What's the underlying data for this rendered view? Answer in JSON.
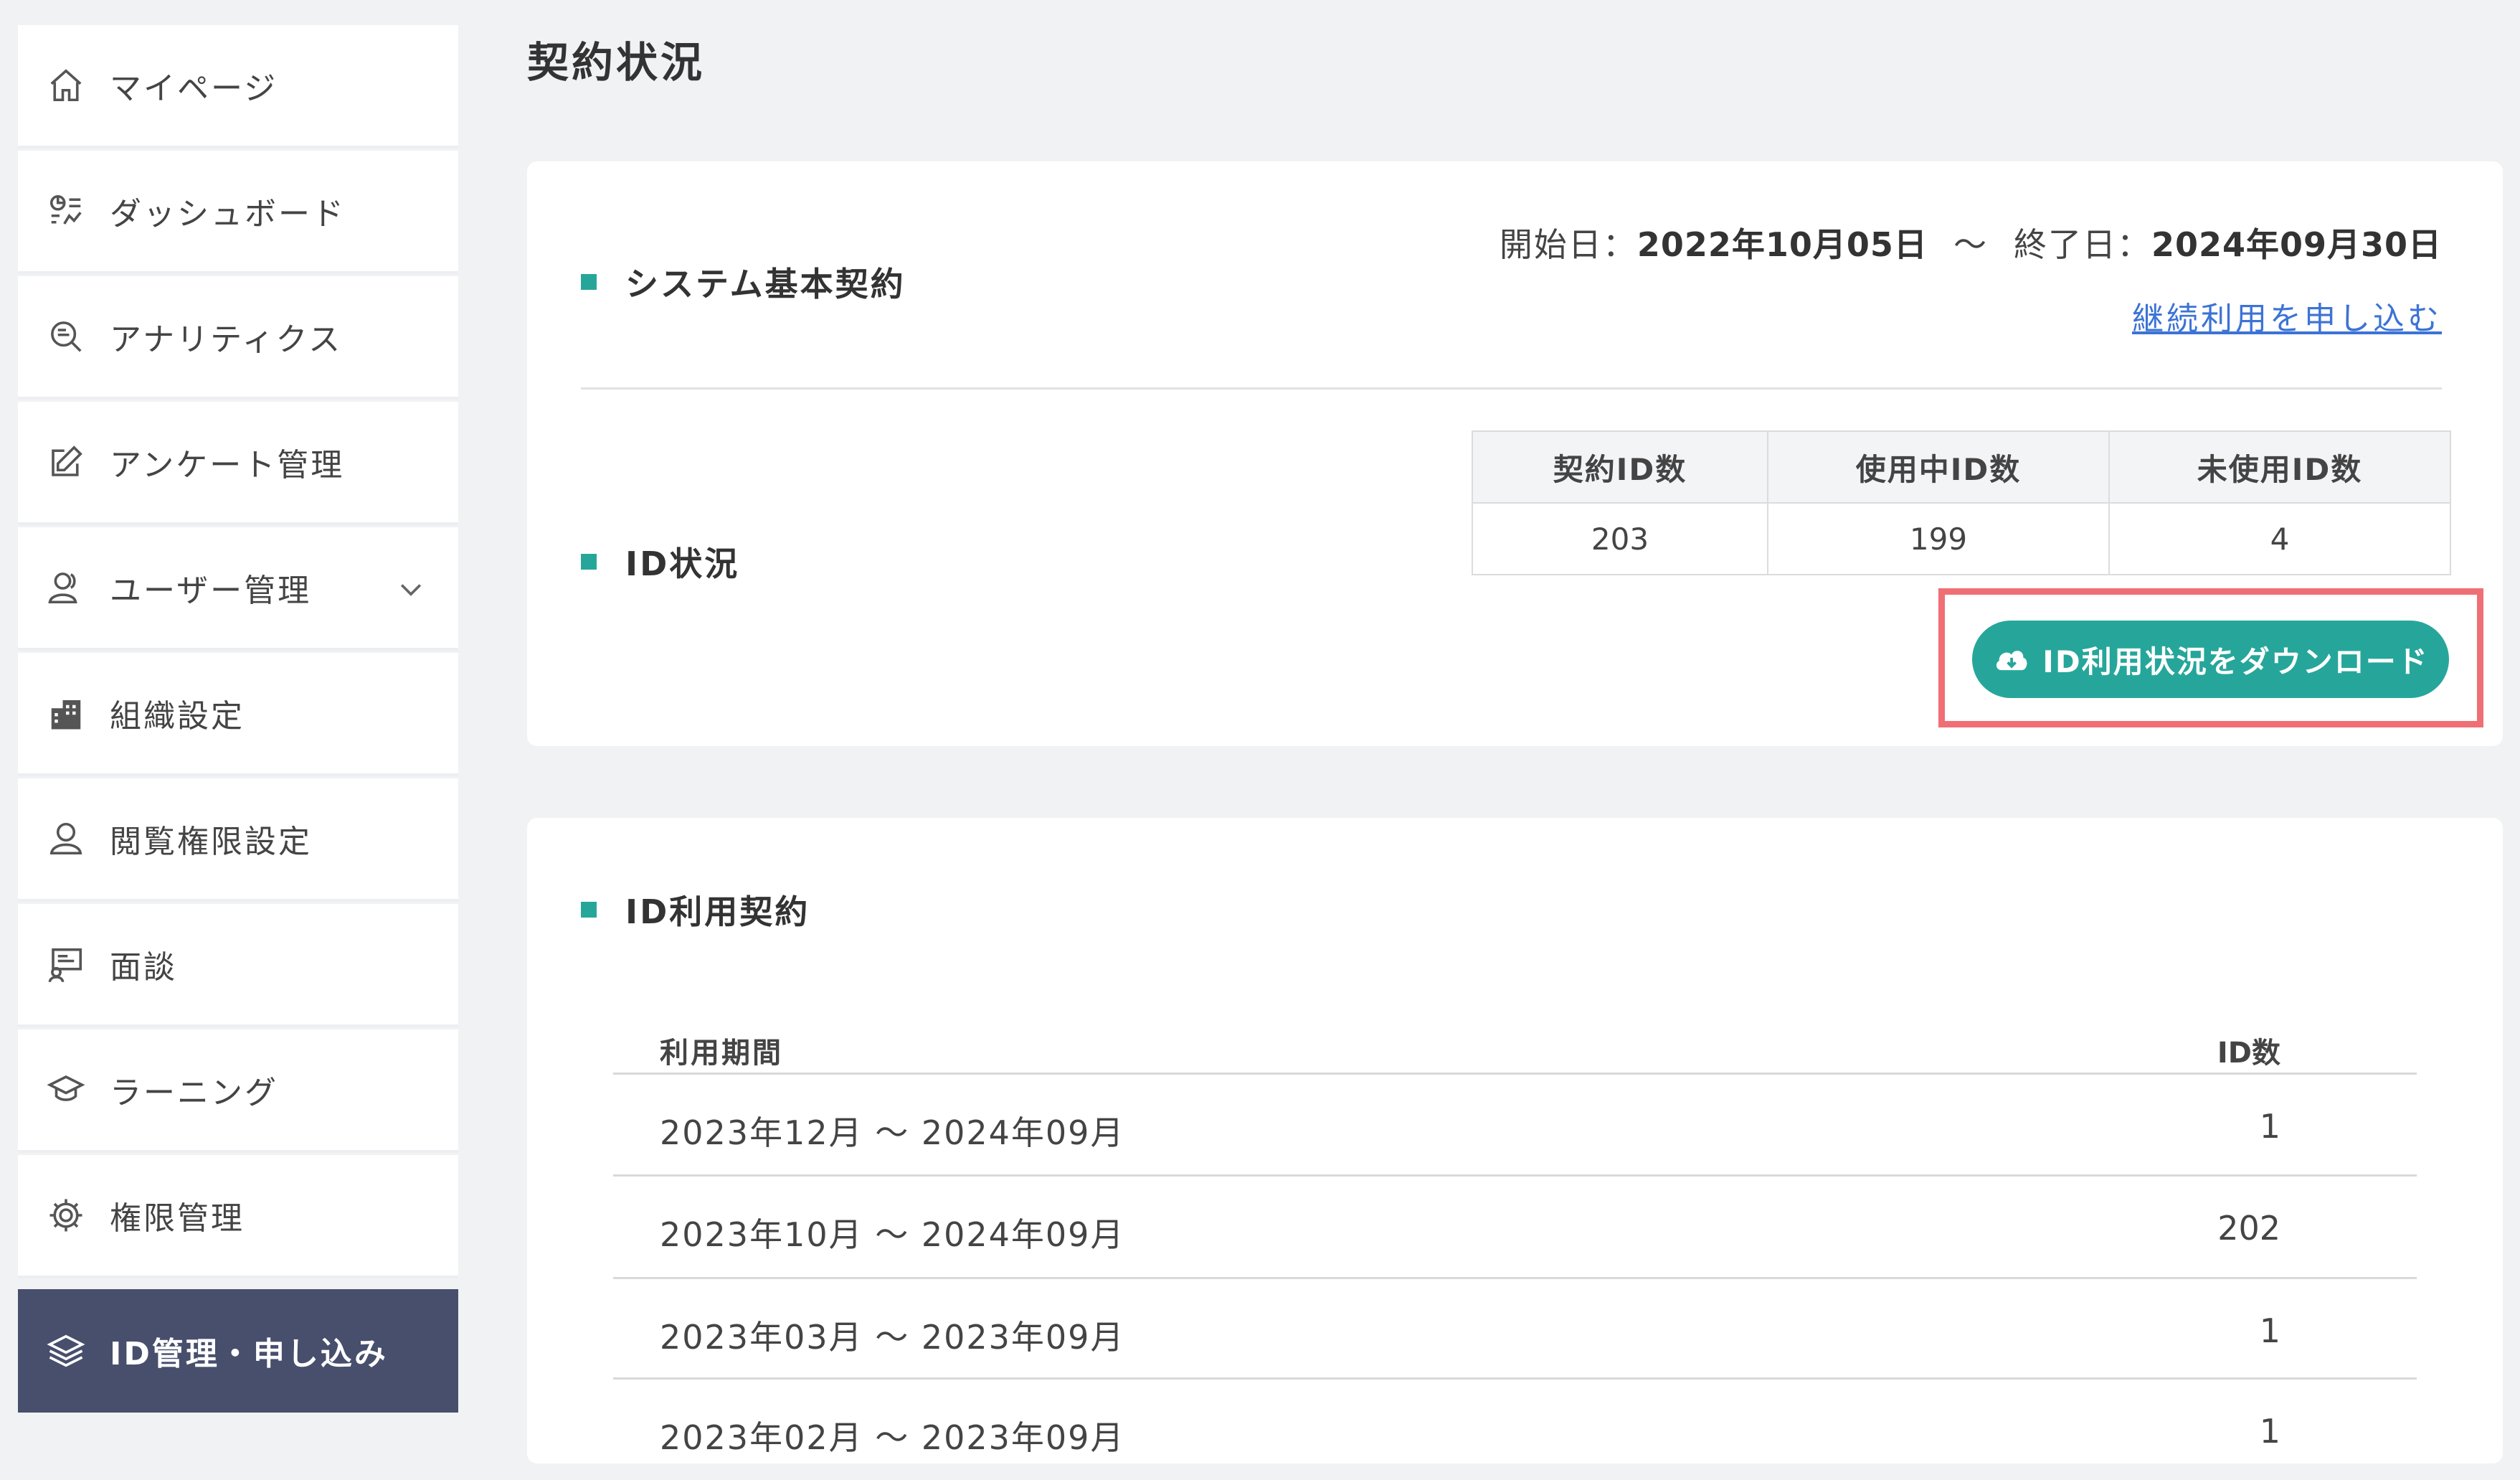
{
  "sidebar": {
    "items": [
      {
        "label": "マイページ",
        "icon": "home-icon"
      },
      {
        "label": "ダッシュボード",
        "icon": "dashboard-icon"
      },
      {
        "label": "アナリティクス",
        "icon": "analytics-search-icon"
      },
      {
        "label": "アンケート管理",
        "icon": "edit-form-icon"
      },
      {
        "label": "ユーザー管理",
        "icon": "users-icon",
        "expand_icon": "chevron-down-icon"
      },
      {
        "label": "組織設定",
        "icon": "building-icon"
      },
      {
        "label": "閲覧権限設定",
        "icon": "person-icon"
      },
      {
        "label": "面談",
        "icon": "presentation-icon"
      },
      {
        "label": "ラーニング",
        "icon": "graduation-cap-icon"
      },
      {
        "label": "権限管理",
        "icon": "gear-icon"
      },
      {
        "label": "ID管理・申し込み",
        "icon": "layers-icon",
        "active": true
      }
    ]
  },
  "main": {
    "page_title": "契約状況",
    "contract": {
      "title": "システム基本契約",
      "start_label": "開始日：",
      "start_date": "2022年10月05日",
      "tilde": "〜",
      "end_label": "終了日：",
      "end_date": "2024年09月30日",
      "renew_link": "継続利用を申し込む"
    },
    "id_status": {
      "title": "ID状況",
      "headers": [
        "契約ID数",
        "使用中ID数",
        "未使用ID数"
      ],
      "values": [
        "203",
        "199",
        "4"
      ],
      "download_button": "ID利用状況をダウンロード",
      "download_icon": "cloud-download-icon"
    },
    "id_usage": {
      "title": "ID利用契約",
      "col_period": "利用期間",
      "col_count": "ID数",
      "rows": [
        {
          "period": "2023年12月 〜 2024年09月",
          "count": "1"
        },
        {
          "period": "2023年10月 〜 2024年09月",
          "count": "202"
        },
        {
          "period": "2023年03月 〜 2023年09月",
          "count": "1"
        },
        {
          "period": "2023年02月 〜 2023年09月",
          "count": "1"
        }
      ]
    }
  },
  "colors": {
    "accent": "#26a69a",
    "sidebar_active": "#474f6d",
    "highlight": "#ef6f75",
    "link": "#3c73d6"
  }
}
